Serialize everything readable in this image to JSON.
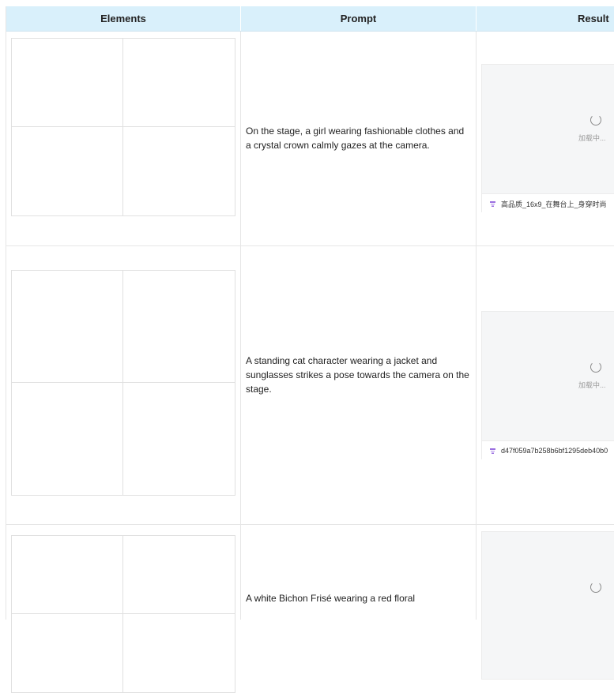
{
  "table": {
    "headers": [
      "Elements",
      "Prompt",
      "Result"
    ],
    "rows": [
      {
        "prompt": "On the stage, a girl wearing fashionable clothes and a crystal crown calmly gazes at the camera.",
        "result": {
          "loading_text": "加载中...",
          "file_name": "高品质_16x9_在舞台上_身穿时尚"
        }
      },
      {
        "prompt": "A standing cat character wearing a jacket and sunglasses strikes a pose towards the camera on the stage.",
        "result": {
          "loading_text": "加载中...",
          "file_name": "d47f059a7b258b6bf1295deb40b0"
        }
      },
      {
        "prompt": "A white Bichon Frisé wearing a red floral",
        "result": {
          "loading_text": "",
          "file_name": ""
        }
      }
    ]
  },
  "colors": {
    "header_bg": "#d9f0fb",
    "file_icon": "#9b6fe0",
    "spinner": "#8a8a8a"
  },
  "icons": {
    "loading": "spinner-icon",
    "file": "image-file-icon"
  }
}
